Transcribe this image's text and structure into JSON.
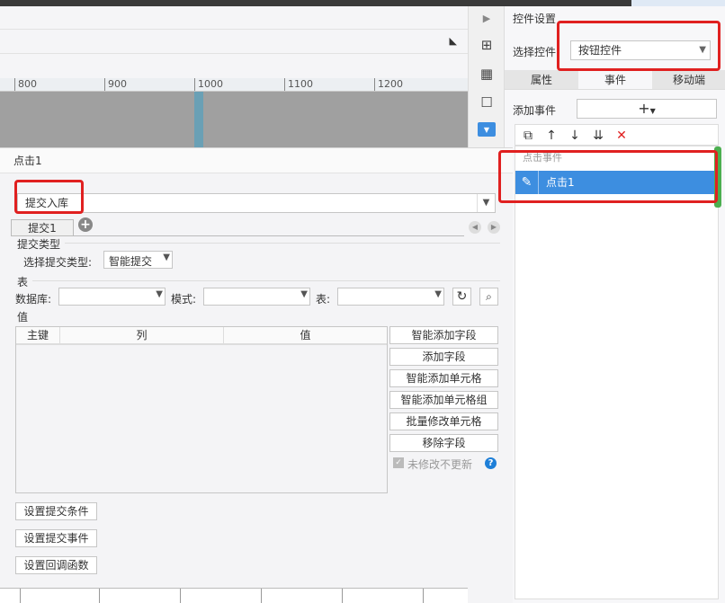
{
  "ruler": {
    "ticks": [
      "800",
      "900",
      "1000",
      "1100",
      "1200"
    ]
  },
  "right_panel": {
    "title": "控件设置",
    "select_label": "选择控件",
    "select_value": "按钮控件",
    "tabs": [
      "属性",
      "事件",
      "移动端"
    ],
    "add_event_label": "添加事件",
    "add_event_icon": "plus-icon",
    "event_list_header": "点击事件",
    "event_item": "点击1"
  },
  "dialog": {
    "title": "点击1",
    "action_type": "提交入库",
    "subtab": "提交1",
    "submit_type_section": "提交类型",
    "submit_type_label": "选择提交类型:",
    "submit_type_value": "智能提交",
    "table_section": "表",
    "db_label": "数据库:",
    "mode_label": "模式:",
    "table_label": "表:",
    "value_section": "值",
    "columns": [
      "主键",
      "列",
      "值"
    ],
    "side_buttons": [
      "智能添加字段",
      "添加字段",
      "智能添加单元格",
      "智能添加单元格组",
      "批量修改单元格",
      "移除字段"
    ],
    "no_update_label": "未修改不更新",
    "bottom_buttons": [
      "设置提交条件",
      "设置提交事件",
      "设置回调函数"
    ]
  },
  "colors": {
    "accent": "#3d8ee0",
    "annotation": "#e02020"
  }
}
